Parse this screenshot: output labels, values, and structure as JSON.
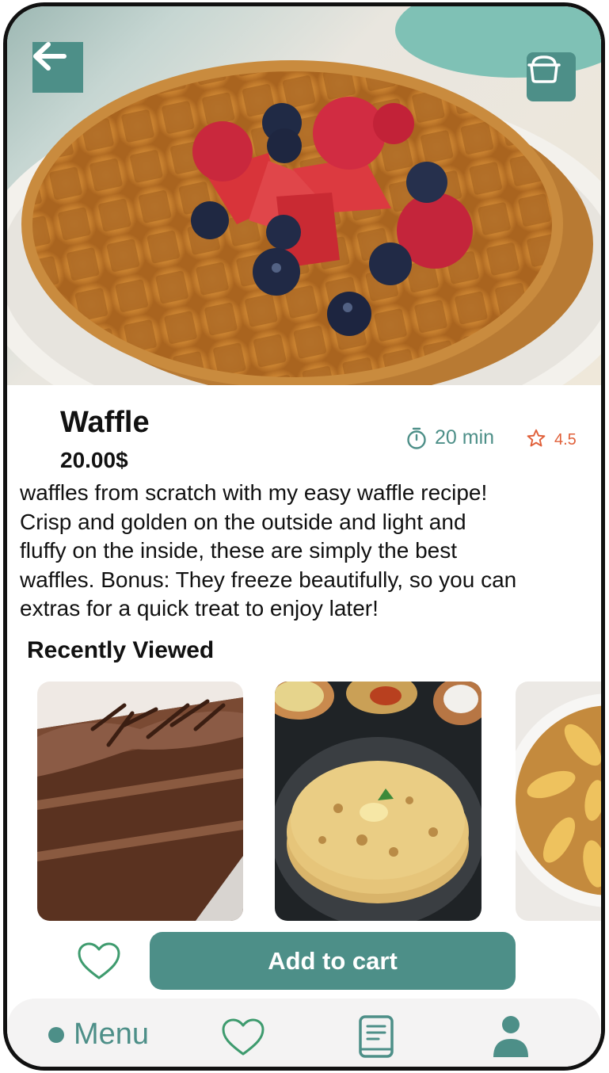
{
  "product": {
    "title": "Waffle",
    "price": "20.00$",
    "time": "20 min",
    "rating": "4.5",
    "description_lines": [
      "waffles from scratch with my easy waffle recipe!",
      "Crisp and golden on the outside and light and",
      "fluffy on the inside, these are simply the best",
      "waffles. Bonus: They freeze beautifully, so you can",
      "extras for a quick treat to enjoy later!"
    ]
  },
  "recently_viewed": {
    "title": "Recently Viewed",
    "items": [
      {
        "image": "chocolate-cake"
      },
      {
        "image": "paratha-flatbread"
      },
      {
        "image": "pear-upside-down-cake"
      }
    ]
  },
  "actions": {
    "add_to_cart": "Add to cart"
  },
  "nav": {
    "menu_label": "Menu"
  },
  "icons": {
    "back": "arrow-left-icon",
    "cooking": "cooking-pot-icon",
    "timer": "timer-icon",
    "star": "star-icon",
    "favorite": "heart-icon",
    "recipe": "recipe-book-icon",
    "profile": "user-icon"
  },
  "colors": {
    "accent": "#4d8f88",
    "rating": "#e0603a",
    "heart": "#3e9b6e",
    "nav_background": "#f4f3f3"
  }
}
